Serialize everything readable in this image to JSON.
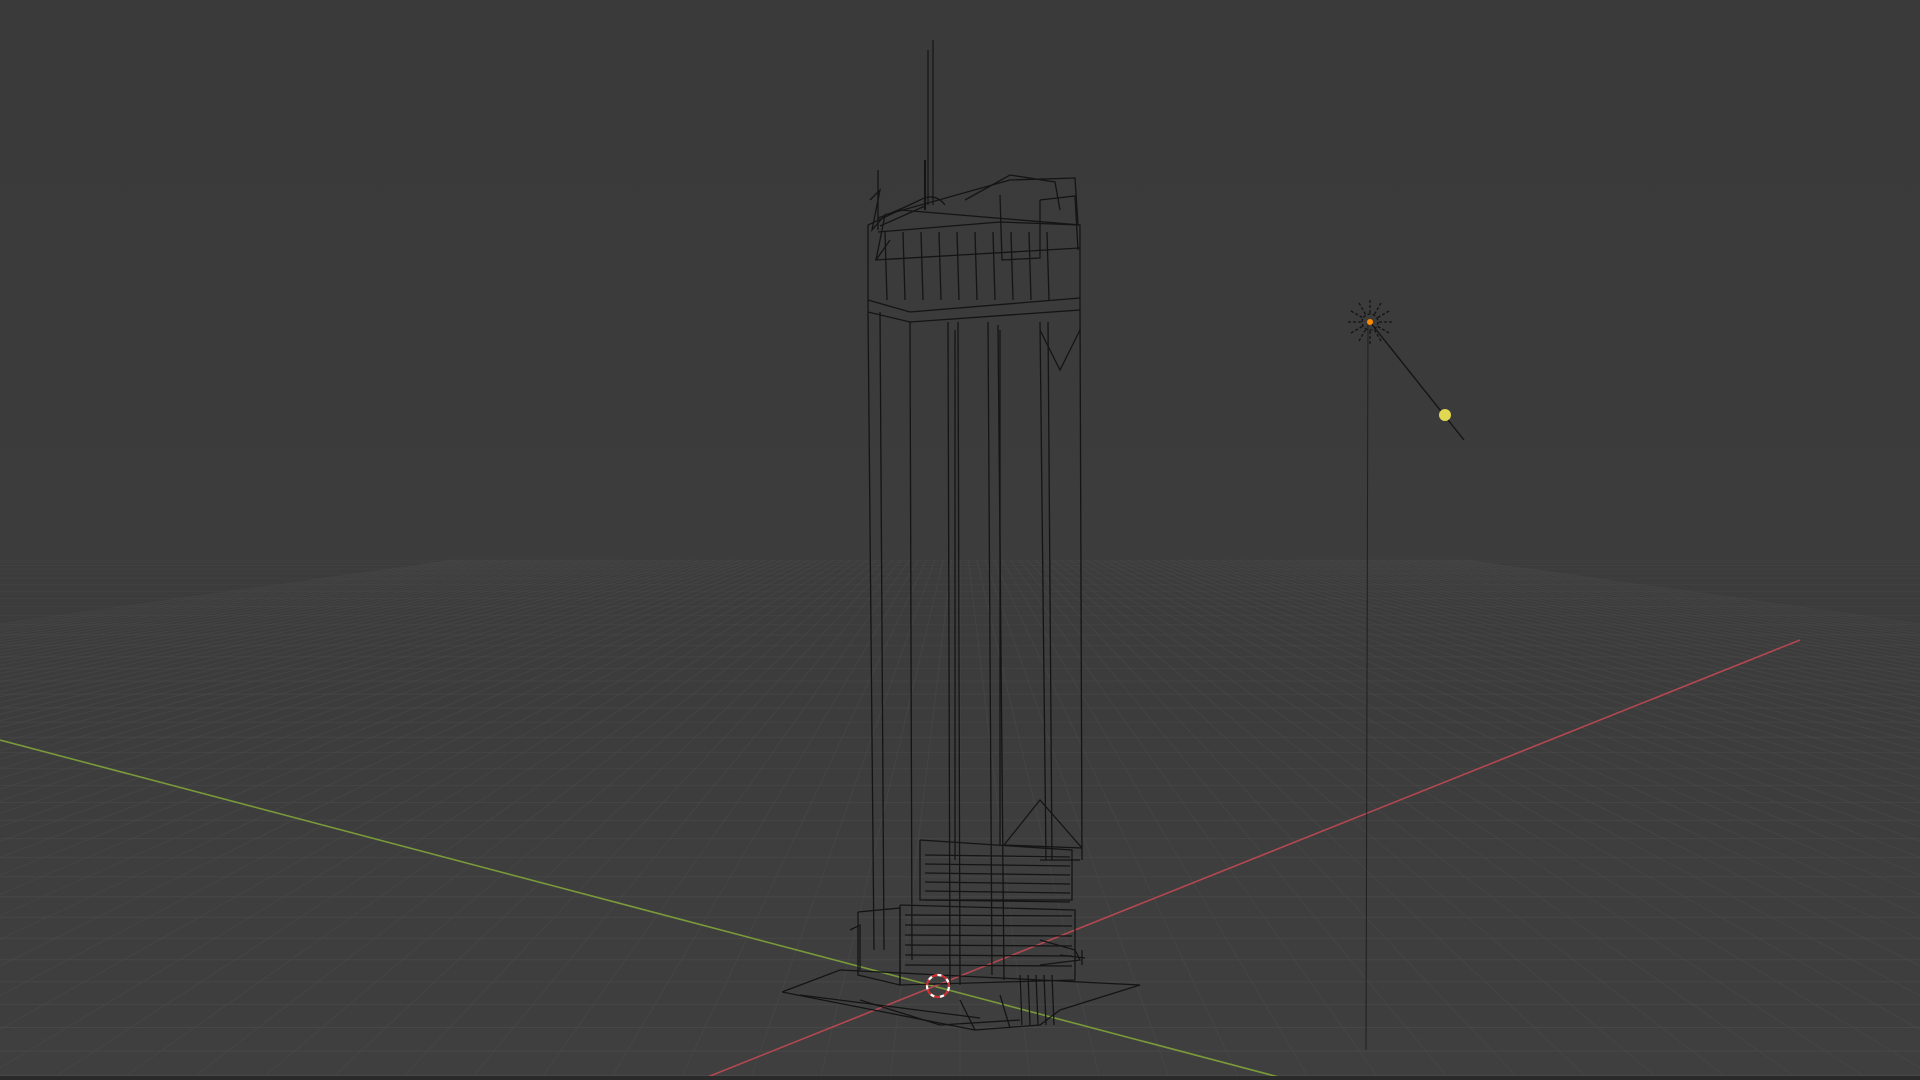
{
  "viewport": {
    "mode": "wireframe",
    "background": "#3d3d3d",
    "grid_color": "#4a4a4a",
    "x_axis_color": "#b54750",
    "y_axis_color": "#7a9a3a",
    "wire_color": "#141414"
  },
  "scene": {
    "objects": [
      {
        "name": "tower-mesh",
        "icon": "wireframe-tower"
      },
      {
        "name": "sun-light",
        "icon": "sun-lamp-icon"
      },
      {
        "name": "3d-cursor",
        "icon": "cursor-target-icon"
      }
    ],
    "light_color": "#e0d850",
    "origin_color": "#ff8a00",
    "cursor_colors": [
      "#ffffff",
      "#d03030"
    ]
  }
}
